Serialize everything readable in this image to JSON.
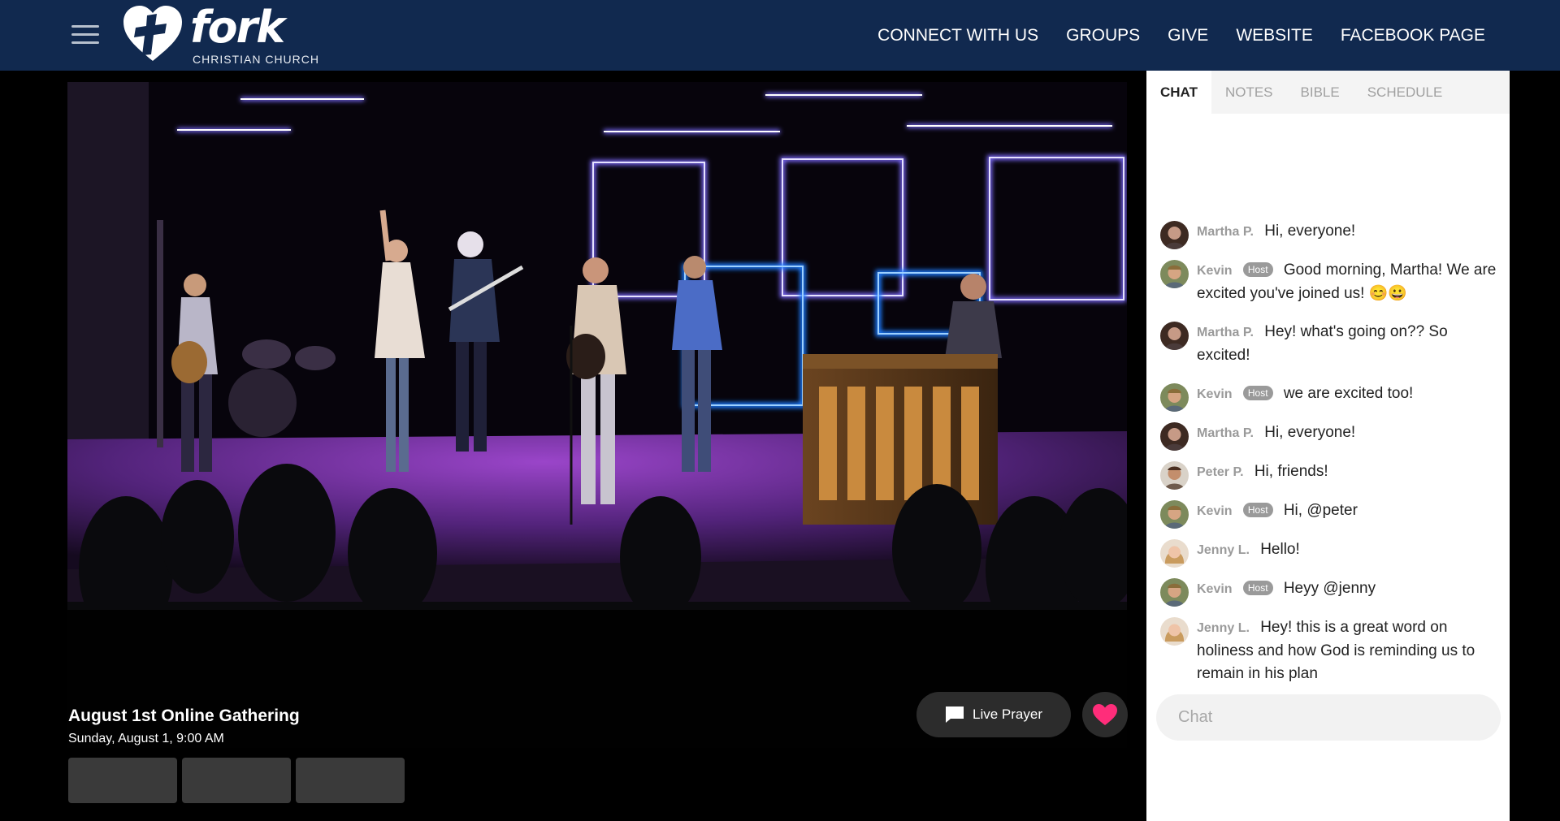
{
  "header": {
    "logo_word": "fork",
    "logo_subtitle": "CHRISTIAN CHURCH",
    "nav": [
      {
        "label": "CONNECT WITH US"
      },
      {
        "label": "GROUPS"
      },
      {
        "label": "GIVE"
      },
      {
        "label": "WEBSITE"
      },
      {
        "label": "FACEBOOK PAGE"
      }
    ]
  },
  "event": {
    "title": "August 1st Online Gathering",
    "date": "Sunday, August 1, 9:00 AM"
  },
  "actions": {
    "live_prayer": "Live Prayer",
    "heart_color": "#ff2d7a"
  },
  "tabs": [
    {
      "label": "CHAT",
      "active": true
    },
    {
      "label": "NOTES",
      "active": false
    },
    {
      "label": "BIBLE",
      "active": false
    },
    {
      "label": "SCHEDULE",
      "active": false
    }
  ],
  "messages": [
    {
      "author": "Martha P.",
      "host": false,
      "text": "Hi, everyone!"
    },
    {
      "author": "Kevin",
      "host": true,
      "badge": "Host",
      "text": "Good morning, Martha! We are excited you've joined us! 😊😀"
    },
    {
      "author": "Martha P.",
      "host": false,
      "text": "Hey! what's going on?? So excited!"
    },
    {
      "author": "Kevin",
      "host": true,
      "badge": "Host",
      "text": "we are excited too!"
    },
    {
      "author": "Martha P.",
      "host": false,
      "text": "Hi, everyone!"
    },
    {
      "author": "Peter P.",
      "host": false,
      "text": "Hi, friends!"
    },
    {
      "author": "Kevin",
      "host": true,
      "badge": "Host",
      "text": "Hi, @peter"
    },
    {
      "author": "Jenny L.",
      "host": false,
      "text": "Hello!"
    },
    {
      "author": "Kevin",
      "host": true,
      "badge": "Host",
      "text": "Heyy @jenny"
    },
    {
      "author": "Jenny L.",
      "host": false,
      "text": "Hey! this is a great word on holiness and how God is reminding us to remain in his plan"
    }
  ],
  "chat_input": {
    "placeholder": "Chat"
  },
  "colors": {
    "header_bg": "#11294f",
    "stage_light": "#6a5cff"
  }
}
